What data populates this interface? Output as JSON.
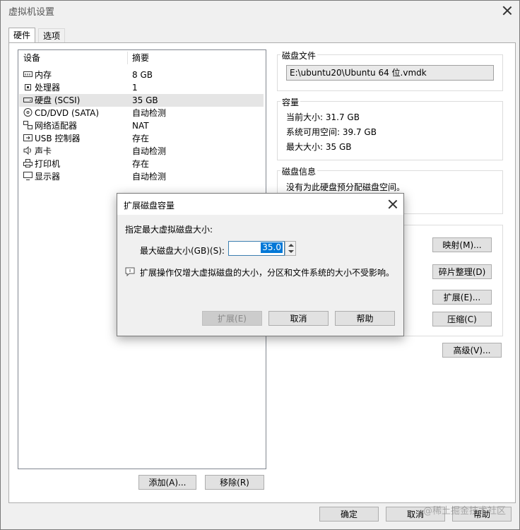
{
  "window": {
    "title": "虚拟机设置"
  },
  "tabs": [
    {
      "label": "硬件"
    },
    {
      "label": "选项"
    }
  ],
  "device_list": {
    "headers": {
      "device": "设备",
      "summary": "摘要"
    },
    "rows": [
      {
        "icon": "memory-icon",
        "device": "内存",
        "summary": "8 GB"
      },
      {
        "icon": "processor-icon",
        "device": "处理器",
        "summary": "1"
      },
      {
        "icon": "hard-disk-icon",
        "device": "硬盘 (SCSI)",
        "summary": "35 GB"
      },
      {
        "icon": "cd-dvd-icon",
        "device": "CD/DVD (SATA)",
        "summary": "自动检测"
      },
      {
        "icon": "network-adapter-icon",
        "device": "网络适配器",
        "summary": "NAT"
      },
      {
        "icon": "usb-icon",
        "device": "USB 控制器",
        "summary": "存在"
      },
      {
        "icon": "sound-card-icon",
        "device": "声卡",
        "summary": "自动检测"
      },
      {
        "icon": "printer-icon",
        "device": "打印机",
        "summary": "存在"
      },
      {
        "icon": "display-icon",
        "device": "显示器",
        "summary": "自动检测"
      }
    ],
    "selected_index": 2,
    "add_button": "添加(A)...",
    "remove_button": "移除(R)"
  },
  "disk_file": {
    "title": "磁盘文件",
    "value": "E:\\ubuntu20\\Ubuntu 64 位.vmdk"
  },
  "capacity": {
    "title": "容量",
    "current_size": "当前大小: 31.7 GB",
    "available_space": "系统可用空间: 39.7 GB",
    "max_size": "最大大小: 35 GB"
  },
  "disk_info": {
    "title": "磁盘信息",
    "text": "没有为此硬盘预分配磁盘空间。"
  },
  "utilities": {
    "map_button": "映射(M)...",
    "defrag_button": "碎片整理(D)",
    "expand_button": "扩展(E)...",
    "compact_button": "压缩(C)",
    "advanced_button": "高级(V)..."
  },
  "footer": {
    "ok_button": "确定",
    "cancel_button": "取消",
    "help_button": "帮助"
  },
  "expand_dialog": {
    "title": "扩展磁盘容量",
    "prompt": "指定最大虚拟磁盘大小:",
    "size_label": "最大磁盘大小(GB)(S):",
    "size_value": "35.0",
    "info_text": "扩展操作仅增大虚拟磁盘的大小，分区和文件系统的大小不受影响。",
    "expand_button": "扩展(E)",
    "cancel_button": "取消",
    "help_button": "帮助"
  },
  "watermark": "@稀土掘金技术社区"
}
